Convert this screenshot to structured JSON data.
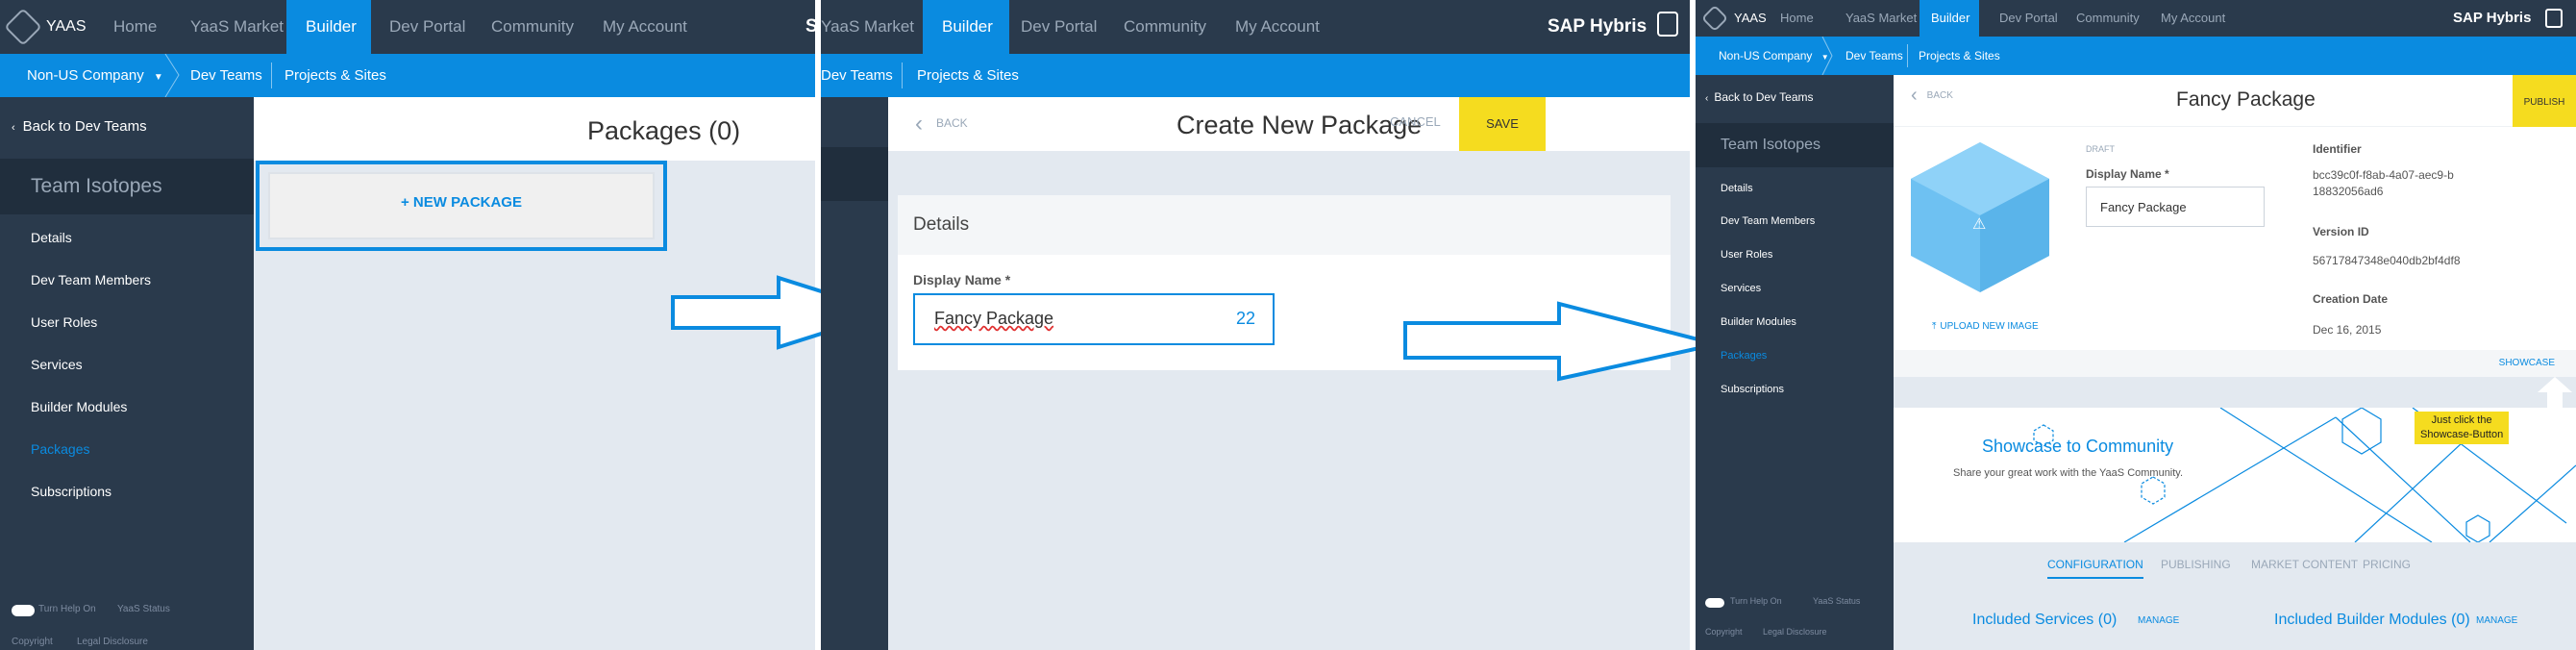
{
  "panel1": {
    "nav": {
      "brand": "YAAS",
      "items": [
        "Home",
        "YaaS Market",
        "Builder",
        "Dev Portal",
        "Community",
        "My Account"
      ],
      "sap": "S"
    },
    "subnav": {
      "company": "Non-US Company",
      "crumbs": [
        "Dev Teams",
        "Projects & Sites"
      ]
    },
    "side": {
      "back": "Back to Dev Teams",
      "team": "Team Isotopes",
      "items": [
        "Details",
        "Dev Team Members",
        "User Roles",
        "Services",
        "Builder Modules",
        "Packages",
        "Subscriptions"
      ],
      "help": "Turn Help On",
      "status": "YaaS Status",
      "copyright": "Copyright",
      "legal": "Legal Disclosure"
    },
    "main": {
      "title": "Packages (0)",
      "new_button": "+ NEW PACKAGE"
    }
  },
  "panel2": {
    "nav": {
      "items": [
        "YaaS Market",
        "Builder",
        "Dev Portal",
        "Community",
        "My Account"
      ],
      "brand": "SAP Hybris"
    },
    "subnav": {
      "crumbs": [
        "Dev Teams",
        "Projects & Sites"
      ]
    },
    "header": {
      "back": "BACK",
      "title": "Create New Package",
      "cancel": "CANCEL",
      "save": "SAVE"
    },
    "details": {
      "heading": "Details",
      "field_label": "Display Name *",
      "field_value": "Fancy Package",
      "counter": "22"
    }
  },
  "panel3": {
    "nav": {
      "brand": "YAAS",
      "items": [
        "Home",
        "YaaS Market",
        "Builder",
        "Dev Portal",
        "Community",
        "My Account"
      ],
      "sap": "SAP Hybris"
    },
    "subnav": {
      "company": "Non-US Company",
      "crumbs": [
        "Dev Teams",
        "Projects & Sites"
      ]
    },
    "side": {
      "back": "Back to Dev Teams",
      "team": "Team Isotopes",
      "items": [
        "Details",
        "Dev Team Members",
        "User Roles",
        "Services",
        "Builder Modules",
        "Packages",
        "Subscriptions"
      ],
      "help": "Turn Help On",
      "status": "YaaS Status",
      "copyright": "Copyright",
      "legal": "Legal Disclosure"
    },
    "header": {
      "back": "BACK",
      "title": "Fancy Package",
      "publish": "PUBLISH"
    },
    "form": {
      "draft": "DRAFT",
      "display_label": "Display Name *",
      "display_value": "Fancy Package",
      "identifier_label": "Identifier",
      "identifier_value": "bcc39c0f-f8ab-4a07-aec9-b18832056ad6",
      "version_label": "Version ID",
      "version_value": "56717847348e040db2bf4df8",
      "created_label": "Creation Date",
      "created_value": "Dec 16, 2015",
      "upload": "UPLOAD NEW IMAGE"
    },
    "showcase": {
      "link": "SHOWCASE",
      "title": "Showcase to Community",
      "subtitle": "Share your great work with the YaaS Community.",
      "tip": [
        "Just click the",
        "Showcase-Button"
      ]
    },
    "tabs": [
      "CONFIGURATION",
      "PUBLISHING",
      "MARKET CONTENT",
      "PRICING"
    ],
    "bottom": {
      "services": "Included Services (0)",
      "manage1": "MANAGE",
      "modules": "Included Builder Modules (0)",
      "manage2": "MANAGE"
    }
  },
  "colors": {
    "nav": "#2a3a4c",
    "accent": "#0a8be0",
    "save": "#f5dc1f",
    "content": "#e3e9f0"
  },
  "icons": [
    "hexagon-logo-icon",
    "chevron-left-icon",
    "caret-down-icon",
    "upload-icon",
    "arrow-up-icon",
    "arrow-right-icon"
  ]
}
